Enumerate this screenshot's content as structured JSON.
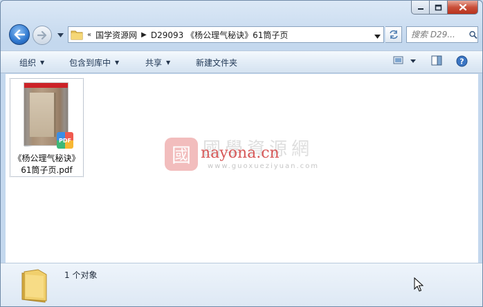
{
  "window": {
    "buttons": {
      "minimize": "minimize",
      "maximize": "maximize",
      "close": "close"
    }
  },
  "address": {
    "overflow": "«",
    "crumbs": [
      "国学资源网",
      "D29093 《杨公理气秘诀》61筒子页"
    ]
  },
  "search": {
    "placeholder": "搜索 D29..."
  },
  "toolbar": {
    "organize": "组织",
    "include_library": "包含到库中",
    "share": "共享",
    "new_folder": "新建文件夹"
  },
  "files": [
    {
      "name_line1": "《杨公理气秘诀》",
      "name_line2": "61筒子页.pdf",
      "thumb_label": "PDF",
      "badge": "PDF"
    }
  ],
  "watermark": {
    "cn": "國學資源網",
    "latin": "nayona.cn",
    "url": "www.guoxueziyuan.com",
    "seal": "國"
  },
  "status": {
    "count_text": "1 个对象"
  },
  "colors": {
    "accent": "#2f78cf",
    "close": "#c9503a",
    "watermark_red": "#cf3a3a"
  }
}
